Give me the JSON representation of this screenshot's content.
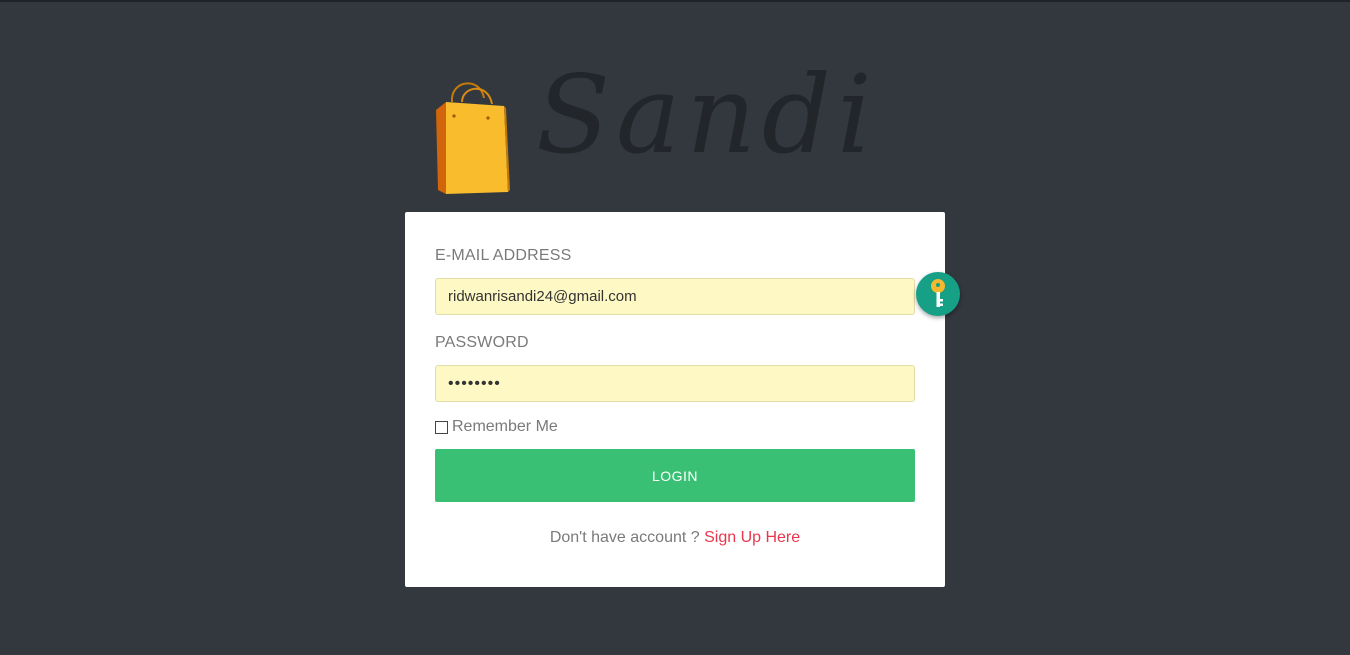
{
  "brand": {
    "name": "Sandi"
  },
  "form": {
    "email_label": "E-MAIL ADDRESS",
    "email_value": "ridwanrisandi24@gmail.com",
    "password_label": "PASSWORD",
    "password_value": "••••••••",
    "remember_label": "Remember Me",
    "remember_checked": false,
    "login_label": "LOGIN",
    "signup_prompt": "Don't have account ?",
    "signup_link": "Sign Up Here"
  },
  "icons": {
    "logo": "shopping-bag-icon",
    "password_manager": "key-icon"
  },
  "colors": {
    "background": "#33373e",
    "login_button": "#3ac074",
    "signup_link": "#e8374d",
    "key_badge": "#16a085",
    "input_fill": "#fef8c5"
  }
}
